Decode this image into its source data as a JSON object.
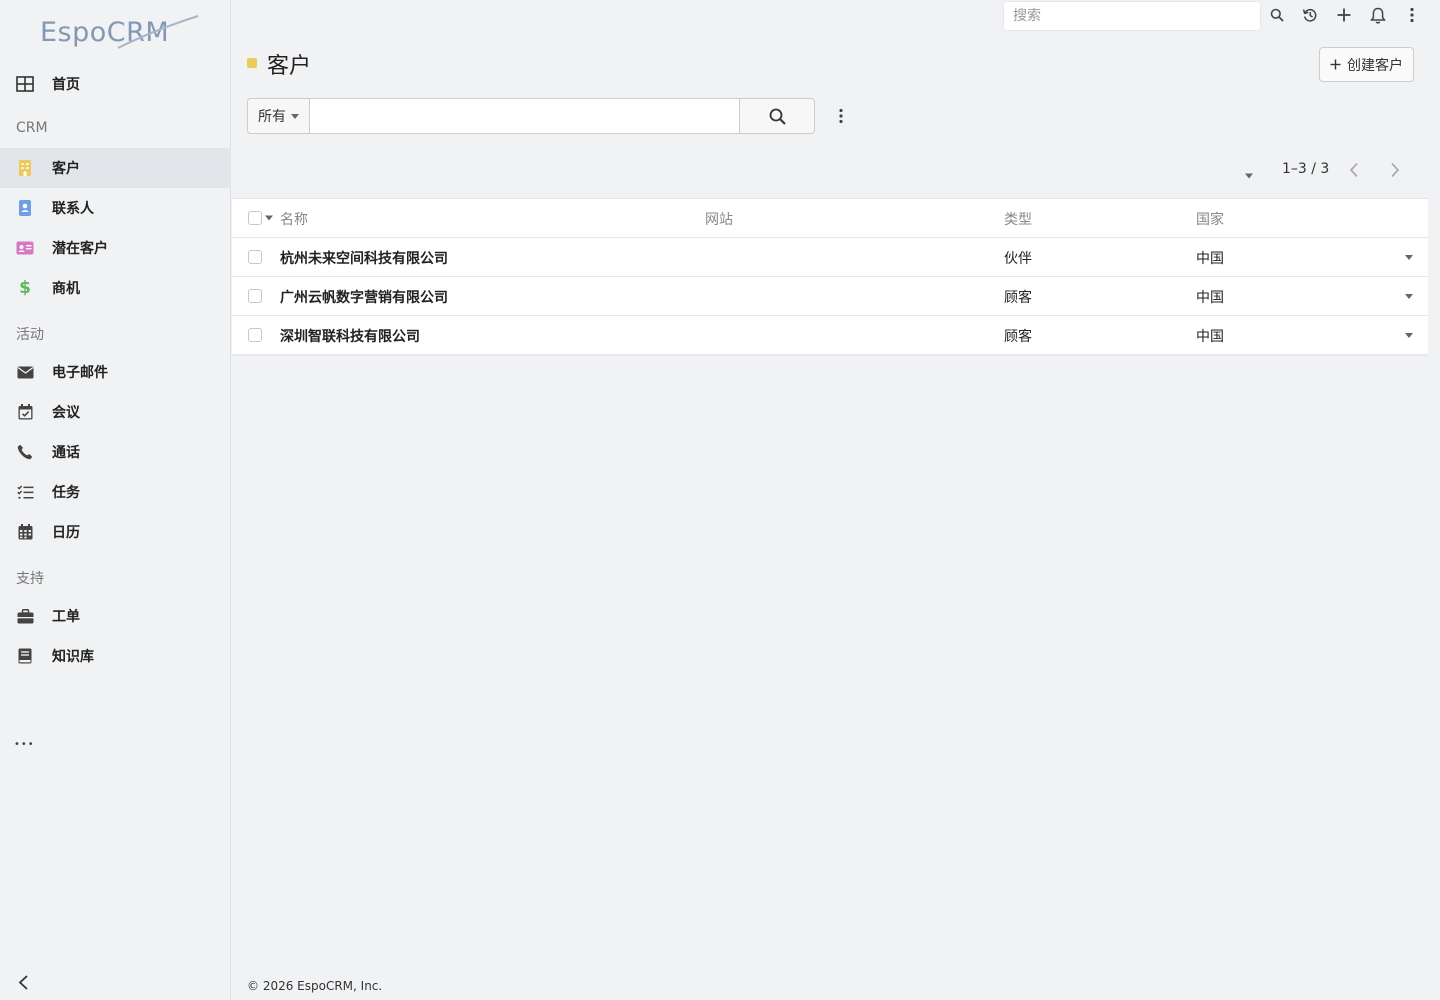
{
  "app": {
    "logo_text": "Espo",
    "logo_text2": "CRM"
  },
  "topbar": {
    "search_placeholder": "搜索"
  },
  "sidebar": {
    "home": "首页",
    "group_crm": "CRM",
    "accounts": "客户",
    "contacts": "联系人",
    "leads": "潜在客户",
    "opportunities": "商机",
    "group_activities": "活动",
    "emails": "电子邮件",
    "meetings": "会议",
    "calls": "通话",
    "tasks": "任务",
    "calendar": "日历",
    "group_support": "支持",
    "cases": "工单",
    "knowledge_base": "知识库",
    "more": "•••"
  },
  "colors": {
    "accounts": "#eccb5e",
    "contacts": "#6d9ee6",
    "leads": "#d678c0",
    "opportunities": "#5cb85c"
  },
  "header": {
    "title": "客户",
    "create_button": "创建客户"
  },
  "filter": {
    "scope": "所有",
    "query": ""
  },
  "pagination": {
    "info": "1–3 / 3"
  },
  "table": {
    "columns": [
      "名称",
      "网站",
      "类型",
      "国家"
    ],
    "rows": [
      {
        "name": "杭州未来空间科技有限公司",
        "website": "",
        "type": "伙伴",
        "country": "中国"
      },
      {
        "name": "广州云帆数字营销有限公司",
        "website": "",
        "type": "顾客",
        "country": "中国"
      },
      {
        "name": "深圳智联科技有限公司",
        "website": "",
        "type": "顾客",
        "country": "中国"
      }
    ]
  },
  "footer": {
    "copyright": "© 2026 EspoCRM, Inc."
  }
}
